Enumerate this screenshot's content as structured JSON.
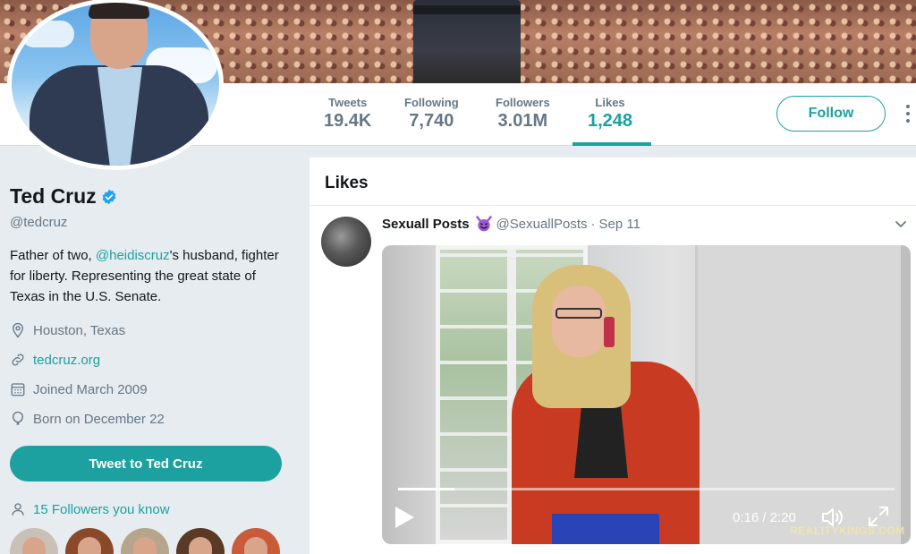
{
  "nav": {
    "stats": [
      {
        "label": "Tweets",
        "value": "19.4K"
      },
      {
        "label": "Following",
        "value": "7,740"
      },
      {
        "label": "Followers",
        "value": "3.01M"
      },
      {
        "label": "Likes",
        "value": "1,248"
      }
    ],
    "active_stat": "Likes",
    "follow_label": "Follow"
  },
  "profile": {
    "name": "Ted Cruz",
    "handle": "@tedcruz",
    "bio_prefix": "Father of two, ",
    "bio_mention": "@heidiscruz",
    "bio_suffix": "'s husband, fighter for liberty. Representing the great state of Texas in the U.S. Senate.",
    "location": "Houston, Texas",
    "website": "tedcruz.org",
    "joined": "Joined March 2009",
    "born": "Born on December 22",
    "tweet_to_label": "Tweet to Ted Cruz",
    "followers_you_know": "15 Followers you know"
  },
  "likes": {
    "header": "Likes",
    "tweet": {
      "name": "Sexuall Posts",
      "emoji": "smiling-devil-emoji",
      "handle": "@SexuallPosts",
      "separator": "·",
      "date": "Sep 11",
      "video": {
        "time": "0:16 / 2:20",
        "progress": 0.114,
        "watermark": "REALITYKINGS.COM"
      }
    }
  },
  "colors": {
    "accent": "#1da0a0",
    "muted": "#657786",
    "background": "#e6ecf0",
    "text": "#14171a"
  },
  "icons": [
    "verified-badge-icon",
    "location-pin-icon",
    "link-icon",
    "calendar-icon",
    "balloon-icon",
    "person-icon",
    "play-icon",
    "volume-icon",
    "expand-icon",
    "caret-down-icon",
    "more-vertical-icon"
  ]
}
